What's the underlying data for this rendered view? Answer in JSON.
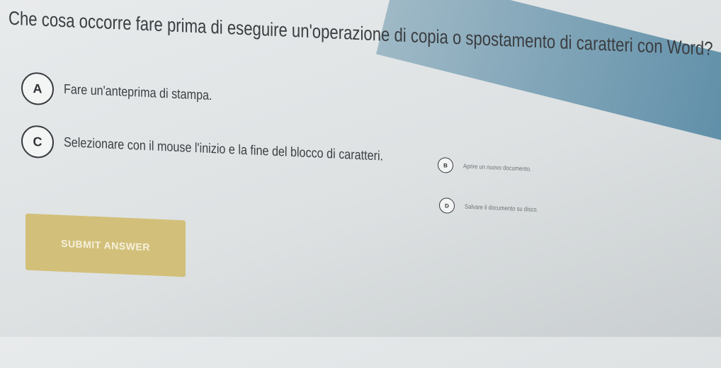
{
  "question": "Che cosa occorre fare prima di eseguire un'operazione di copia o spostamento di caratteri con Word?",
  "options": [
    {
      "letter": "A",
      "text": "Fare un'anteprima di stampa."
    },
    {
      "letter": "B",
      "text": "Aprire un nuovo documento."
    },
    {
      "letter": "C",
      "text": "Selezionare con il mouse l'inizio e la fine del blocco di caratteri."
    },
    {
      "letter": "D",
      "text": "Salvare il documento su disco."
    }
  ],
  "submit_label": "SUBMIT ANSWER"
}
